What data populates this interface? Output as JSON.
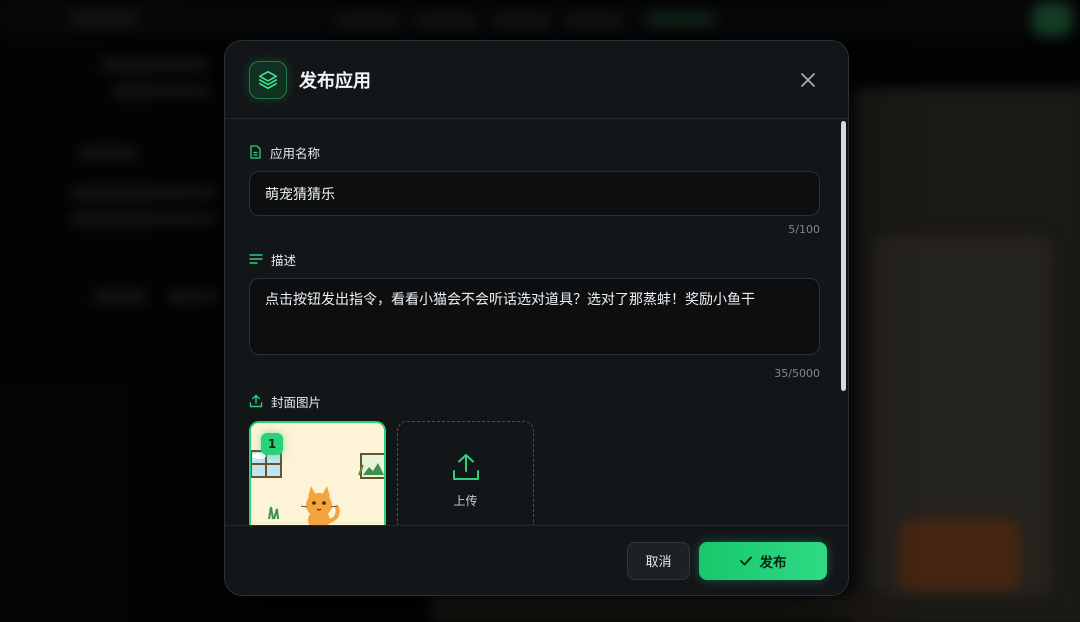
{
  "dialog": {
    "title": "发布应用",
    "app_name": {
      "label": "应用名称",
      "value": "萌宠猜猜乐",
      "counter": "5/100"
    },
    "description": {
      "label": "描述",
      "value": "点击按钮发出指令，看看小猫会不会听话选对道具？选对了那蒸蚌！奖励小鱼干",
      "counter": "35/5000"
    },
    "cover": {
      "label": "封面图片",
      "images": [
        {
          "index": "1"
        }
      ],
      "upload_label": "上传"
    },
    "footer": {
      "cancel_label": "取消",
      "publish_label": "发布"
    }
  },
  "colors": {
    "accent": "#2bd07a",
    "panel": "#131618",
    "input_bg": "#0c0e10"
  },
  "icons": [
    "layers-icon",
    "close-icon",
    "file-icon",
    "lines-icon",
    "upload-icon",
    "check-icon"
  ]
}
